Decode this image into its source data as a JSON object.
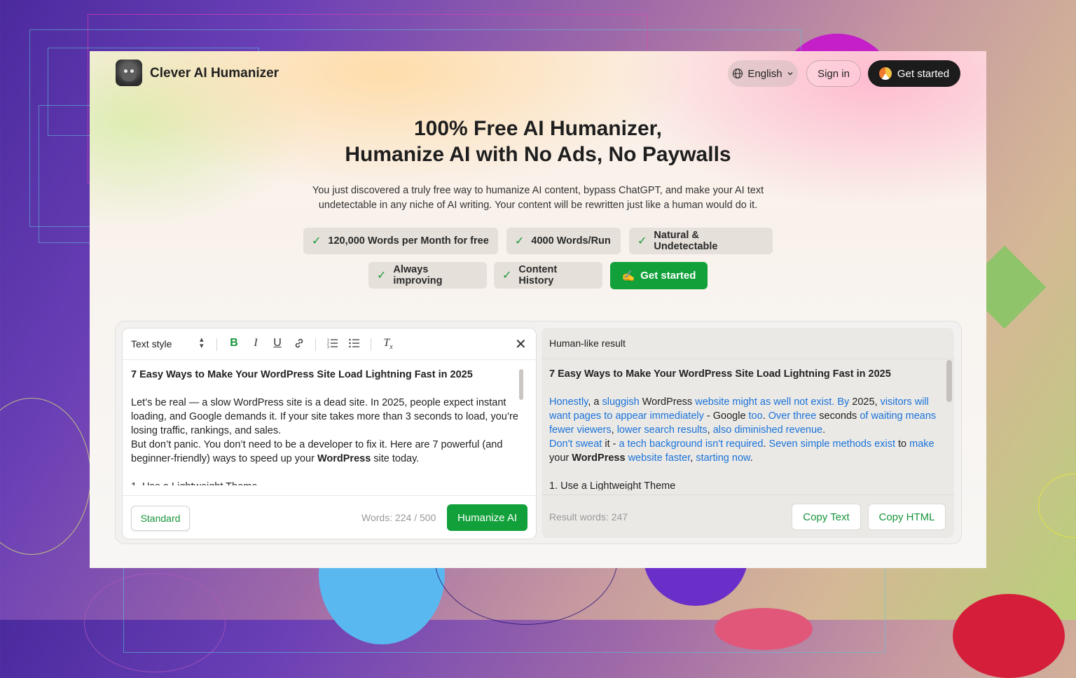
{
  "header": {
    "brand": "Clever AI Humanizer",
    "language": "English",
    "sign_in": "Sign in",
    "get_started": "Get started"
  },
  "hero": {
    "title_line1": "100% Free AI Humanizer,",
    "title_line2": "Humanize AI with No Ads, No Paywalls",
    "subtitle": "You just discovered a truly free way to humanize AI content, bypass ChatGPT, and make your AI text undetectable in any niche of AI writing. Your content will be rewritten just like a human would do it."
  },
  "features": [
    "120,000 Words per Month for free",
    "4000 Words/Run",
    "Natural & Undetectable",
    "Always improving",
    "Content History"
  ],
  "cta": {
    "icon": "✍️",
    "label": "Get started"
  },
  "editor": {
    "text_style": "Text style",
    "title": "7 Easy Ways to Make Your WordPress Site Load Lightning Fast in 2025",
    "para1": "Let’s be real — a slow WordPress site is a dead site. In 2025, people expect instant loading, and Google demands it. If your site takes more than 3 seconds to load, you’re losing traffic, rankings, and sales.",
    "para2_start": "But don’t panic. You don’t need to be a developer to fix it. Here are 7 powerful (and beginner-friendly) ways to speed up your ",
    "para2_bold": "WordPress",
    "para2_end": " site today.",
    "partial_line": "1. Use a Lightweight Theme",
    "mode": "Standard",
    "word_count": "Words: 224 / 500",
    "humanize": "Humanize AI"
  },
  "result": {
    "label": "Human-like result",
    "title": "7 Easy Ways to Make Your WordPress Site Load Lightning Fast in 2025",
    "p1": {
      "a": "Honestly",
      "b": ", a ",
      "c": "sluggish",
      "d": " WordPress ",
      "e": "website might as well not exist.",
      "f": " ",
      "g": "By",
      "h": " 2025, ",
      "i": "visitors will want pages to appear immediately",
      "j": " - Google ",
      "k": "too",
      "l": ". ",
      "m": "Over three",
      "n": " seconds ",
      "o": "of waiting means fewer viewers",
      "p": ", ",
      "q": "lower search results",
      "r": ", ",
      "s": "also diminished revenue",
      "t": "."
    },
    "p2": {
      "a": "Don't sweat",
      "b": " it - ",
      "c": "a tech background isn't required",
      "d": ". ",
      "e": "Seven simple methods exist",
      "f": " to ",
      "g": "make",
      "h": " your ",
      "i": "WordPress",
      "j": " ",
      "k": "website faster",
      "l": ", ",
      "m": "starting now",
      "n": "."
    },
    "list_item": "1. Use a Lightweight Theme",
    "word_count": "Result words: 247",
    "copy_text": "Copy Text",
    "copy_html": "Copy HTML"
  },
  "colors": {
    "accent_green": "#11a03a",
    "link_blue": "#1a73d9",
    "dark_button": "#1c1c1c"
  }
}
